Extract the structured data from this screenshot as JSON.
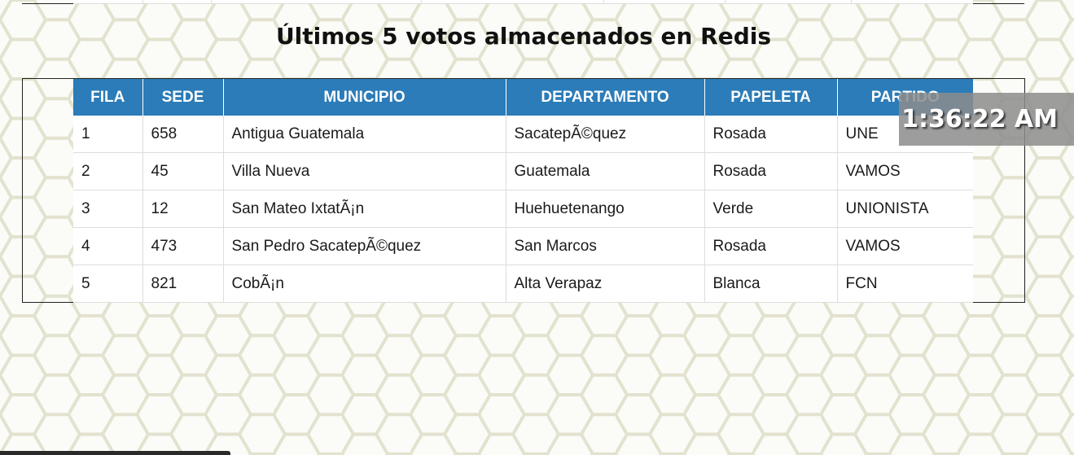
{
  "title": "Últimos 5 votos almacenados en Redis",
  "clock": "1:36:22 AM",
  "table": {
    "headers": [
      "FILA",
      "SEDE",
      "MUNICIPIO",
      "DEPARTAMENTO",
      "PAPELETA",
      "PARTIDO"
    ],
    "rows": [
      [
        "1",
        "658",
        "Antigua Guatemala",
        "SacatepÃ©quez",
        "Rosada",
        "UNE"
      ],
      [
        "2",
        "45",
        "Villa Nueva",
        "Guatemala",
        "Rosada",
        "VAMOS"
      ],
      [
        "3",
        "12",
        "San Mateo IxtatÃ¡n",
        "Huehuetenango",
        "Verde",
        "UNIONISTA"
      ],
      [
        "4",
        "473",
        "San Pedro SacatepÃ©quez",
        "San Marcos",
        "Rosada",
        "VAMOS"
      ],
      [
        "5",
        "821",
        "CobÃ¡n",
        "Alta Verapaz",
        "Blanca",
        "FCN"
      ]
    ]
  },
  "colors": {
    "header_bg": "#2b7cb8",
    "page_bg": "#fbfbf7",
    "hex_lines": "#e4e4d2"
  }
}
